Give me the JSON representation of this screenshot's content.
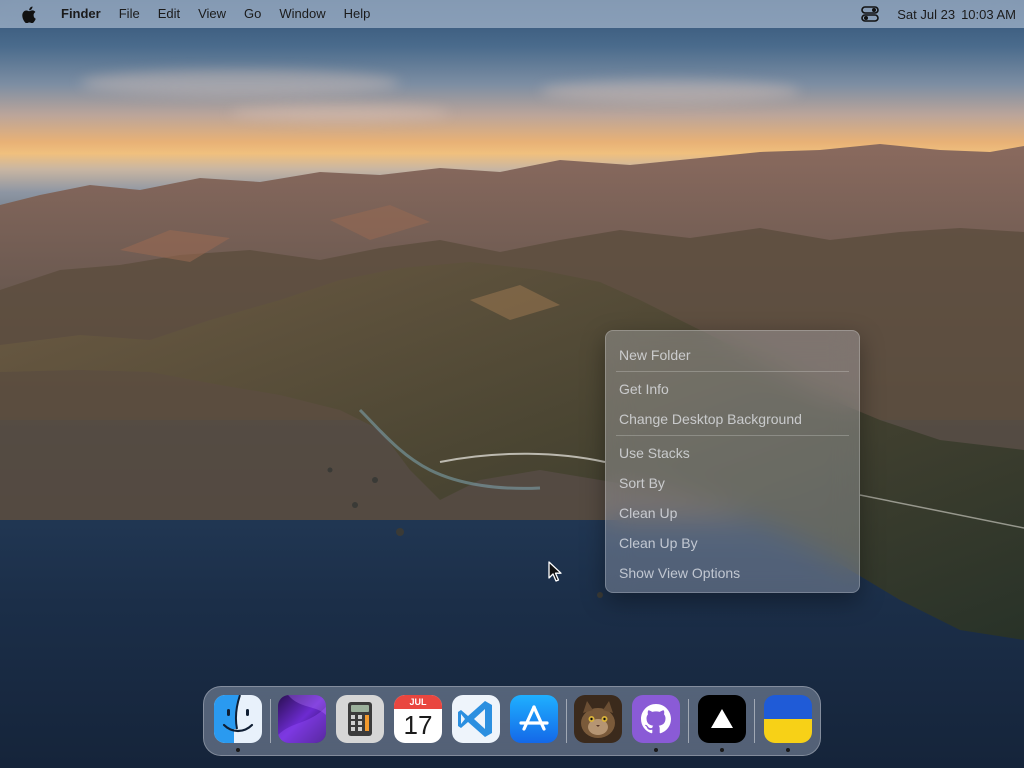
{
  "menubar": {
    "apple_icon": "apple-logo-icon",
    "app_name": "Finder",
    "menus": [
      "File",
      "Edit",
      "View",
      "Go",
      "Window",
      "Help"
    ],
    "control_center_icon": "control-center-icon",
    "date": "Sat Jul 23",
    "time": "10:03 AM"
  },
  "context_menu": {
    "groups": [
      [
        "New Folder"
      ],
      [
        "Get Info",
        "Change Desktop Background"
      ],
      [
        "Use Stacks",
        "Sort By",
        "Clean Up",
        "Clean Up By",
        "Show View Options"
      ]
    ]
  },
  "dock": {
    "apps": [
      {
        "name": "Finder",
        "icon": "finder-icon",
        "running": true
      },
      {
        "name": "Wallpaper",
        "icon": "purple-wallpaper-icon",
        "running": false
      },
      {
        "name": "Calculator",
        "icon": "calculator-icon",
        "running": false
      },
      {
        "name": "Calendar",
        "icon": "calendar-icon",
        "running": false,
        "month": "JUL",
        "day": "17"
      },
      {
        "name": "Visual Studio Code",
        "icon": "vscode-icon",
        "running": false
      },
      {
        "name": "App Store",
        "icon": "app-store-icon",
        "running": false
      },
      {
        "name": "Cat Photo",
        "icon": "cat-photo-icon",
        "running": false
      },
      {
        "name": "GitHub Desktop",
        "icon": "github-icon",
        "running": true
      },
      {
        "name": "Vercel",
        "icon": "vercel-triangle-icon",
        "running": true
      },
      {
        "name": "Ukraine Flag",
        "icon": "ukraine-flag-icon",
        "running": true
      }
    ]
  },
  "colors": {
    "calendar_red": "#e9463f",
    "vscode_blue": "#2b8fe0",
    "appstore_blue": "#1b8cf5",
    "github_purple": "#8a5bd6",
    "ukraine_blue": "#1f5bd7",
    "ukraine_yellow": "#f7d117"
  }
}
